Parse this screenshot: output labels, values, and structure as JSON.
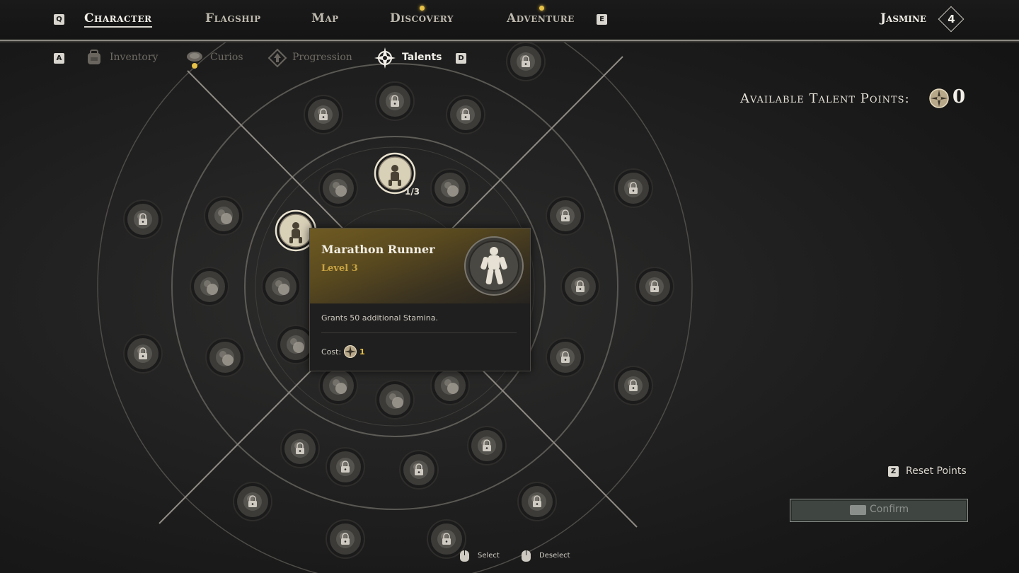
{
  "nav": {
    "prev_key": "Q",
    "next_key": "E",
    "tabs": [
      {
        "label": "Character",
        "active": true,
        "notify": false
      },
      {
        "label": "Flagship",
        "active": false,
        "notify": false
      },
      {
        "label": "Map",
        "active": false,
        "notify": false
      },
      {
        "label": "Discovery",
        "active": false,
        "notify": true
      },
      {
        "label": "Adventure",
        "active": false,
        "notify": true
      }
    ],
    "player_name": "Jasmine",
    "player_level": "4"
  },
  "subnav": {
    "prev_key": "A",
    "next_key": "D",
    "tabs": [
      {
        "label": "Inventory",
        "icon": "backpack-icon",
        "active": false
      },
      {
        "label": "Curios",
        "icon": "curio-icon",
        "active": false
      },
      {
        "label": "Progression",
        "icon": "progression-icon",
        "active": false
      },
      {
        "label": "Talents",
        "icon": "compass-star-icon",
        "active": true
      }
    ]
  },
  "talent_points": {
    "label": "Available Talent Points:",
    "value": "0"
  },
  "tree": {
    "unlocked_badge": "1/3"
  },
  "tooltip": {
    "title": "Marathon Runner",
    "level": "Level 3",
    "description": "Grants 50 additional Stamina.",
    "cost_label": "Cost:",
    "cost_value": "1"
  },
  "actions": {
    "reset_key": "Z",
    "reset_label": "Reset Points",
    "confirm_label": "Confirm"
  },
  "hints": {
    "select": "Select",
    "deselect": "Deselect"
  },
  "colors": {
    "accent_gold": "#e8c247",
    "tooltip_level": "#c9a443"
  }
}
